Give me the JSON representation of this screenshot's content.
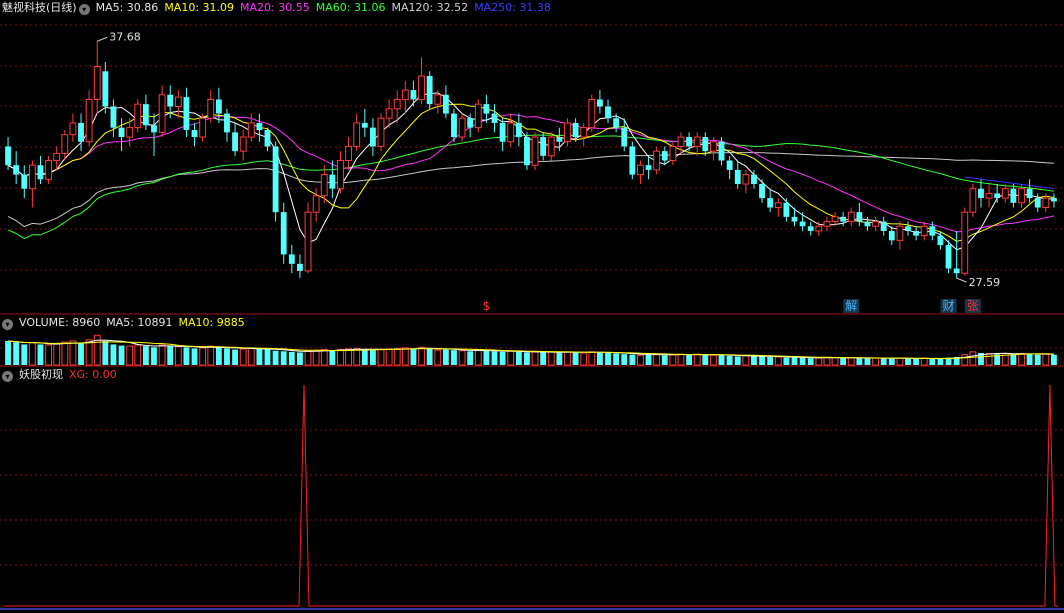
{
  "main_legend": {
    "stock": "魅视科技(日线)",
    "ma5": "MA5: 30.86",
    "ma10": "MA10: 31.09",
    "ma20": "MA20: 30.55",
    "ma60": "MA60: 31.06",
    "ma120": "MA120: 32.52",
    "ma250": "MA250: 31.38"
  },
  "volume_legend": {
    "volume": "VOLUME: 8960",
    "ma5": "MA5: 10891",
    "ma10": "MA10: 9885"
  },
  "indicator_legend": {
    "name": "妖股初现",
    "xg": "XG: 0.00"
  },
  "price_annotations": {
    "high": "37.68",
    "low": "27.59"
  },
  "event_markers": [
    {
      "label": "$",
      "color": "#ff3030"
    },
    {
      "label": "解",
      "color": "#4ab4ff"
    },
    {
      "label": "财",
      "color": "#4ab4ff"
    },
    {
      "label": "张",
      "color": "#ff3030"
    }
  ],
  "colors": {
    "up": "#ff3b3b",
    "down": "#54ffff",
    "ma5": "#ffffff",
    "ma10": "#ffff00",
    "ma20": "#ff33ff",
    "ma60": "#33ff33",
    "ma120": "#c8c8c8",
    "ma250": "#3333ff",
    "grid": "#7a1010",
    "separator": "#a01010"
  },
  "chart_data": [
    {
      "type": "candlestick",
      "title": "魅视科技(日线)",
      "ylim": [
        27.0,
        38.5
      ],
      "candles": [
        [
          33.2,
          33.6,
          32.2,
          32.4
        ],
        [
          32.4,
          33.0,
          31.6,
          32.0
        ],
        [
          32.0,
          32.4,
          31.0,
          31.4
        ],
        [
          31.4,
          32.6,
          30.6,
          32.4
        ],
        [
          32.4,
          32.8,
          31.6,
          31.8
        ],
        [
          31.8,
          32.8,
          31.6,
          32.6
        ],
        [
          32.6,
          33.2,
          32.2,
          32.9
        ],
        [
          32.9,
          33.9,
          32.6,
          33.7
        ],
        [
          33.7,
          34.6,
          33.4,
          34.2
        ],
        [
          34.2,
          34.6,
          33.0,
          33.4
        ],
        [
          33.4,
          35.6,
          33.2,
          35.2
        ],
        [
          35.2,
          37.68,
          34.6,
          36.6
        ],
        [
          36.4,
          36.8,
          34.6,
          34.9
        ],
        [
          34.9,
          35.2,
          33.6,
          34.0
        ],
        [
          34.0,
          34.4,
          33.0,
          33.6
        ],
        [
          33.6,
          34.4,
          33.2,
          34.0
        ],
        [
          34.0,
          35.2,
          33.8,
          35.0
        ],
        [
          35.0,
          35.4,
          33.9,
          34.1
        ],
        [
          34.1,
          34.6,
          32.8,
          33.8
        ],
        [
          33.8,
          35.8,
          33.6,
          35.4
        ],
        [
          35.4,
          35.8,
          34.4,
          34.9
        ],
        [
          34.9,
          35.6,
          34.4,
          35.3
        ],
        [
          35.3,
          35.7,
          33.6,
          33.9
        ],
        [
          33.9,
          34.2,
          33.2,
          33.6
        ],
        [
          33.6,
          34.6,
          33.4,
          34.4
        ],
        [
          34.4,
          35.6,
          34.2,
          35.2
        ],
        [
          35.2,
          35.7,
          34.2,
          34.6
        ],
        [
          34.6,
          34.8,
          33.4,
          33.8
        ],
        [
          33.8,
          34.2,
          32.8,
          33.0
        ],
        [
          33.0,
          33.9,
          32.6,
          33.6
        ],
        [
          33.6,
          34.6,
          33.4,
          34.2
        ],
        [
          34.2,
          34.6,
          33.4,
          33.9
        ],
        [
          33.9,
          34.0,
          33.0,
          33.2
        ],
        [
          33.2,
          33.4,
          30.0,
          30.4
        ],
        [
          30.4,
          30.8,
          28.2,
          28.6
        ],
        [
          28.6,
          29.0,
          27.8,
          28.2
        ],
        [
          28.2,
          28.6,
          27.6,
          27.9
        ],
        [
          27.9,
          30.8,
          27.8,
          30.4
        ],
        [
          30.4,
          31.4,
          30.0,
          31.1
        ],
        [
          31.1,
          32.4,
          30.8,
          32.0
        ],
        [
          32.0,
          32.6,
          31.0,
          31.4
        ],
        [
          31.4,
          33.0,
          31.2,
          32.6
        ],
        [
          32.6,
          33.6,
          32.2,
          33.2
        ],
        [
          33.2,
          34.6,
          33.0,
          34.2
        ],
        [
          34.2,
          34.8,
          33.6,
          34.0
        ],
        [
          34.0,
          34.4,
          32.8,
          33.2
        ],
        [
          33.2,
          34.6,
          33.0,
          34.4
        ],
        [
          34.4,
          35.2,
          34.0,
          34.8
        ],
        [
          34.8,
          35.6,
          34.2,
          35.2
        ],
        [
          35.2,
          36.0,
          34.6,
          35.6
        ],
        [
          35.6,
          36.0,
          34.9,
          35.2
        ],
        [
          35.2,
          37.0,
          35.0,
          36.2
        ],
        [
          36.2,
          36.4,
          34.8,
          35.0
        ],
        [
          35.0,
          35.6,
          34.6,
          35.4
        ],
        [
          35.4,
          35.8,
          34.4,
          34.6
        ],
        [
          34.6,
          34.8,
          33.4,
          33.6
        ],
        [
          33.6,
          34.6,
          33.4,
          34.4
        ],
        [
          34.4,
          34.6,
          33.6,
          34.0
        ],
        [
          34.0,
          35.2,
          33.8,
          35.0
        ],
        [
          35.0,
          35.4,
          34.2,
          34.6
        ],
        [
          34.6,
          35.0,
          33.8,
          34.2
        ],
        [
          34.2,
          34.4,
          33.0,
          33.4
        ],
        [
          33.4,
          34.6,
          33.2,
          34.2
        ],
        [
          34.2,
          34.6,
          33.2,
          33.6
        ],
        [
          33.6,
          33.8,
          32.2,
          32.4
        ],
        [
          32.4,
          33.8,
          32.2,
          33.6
        ],
        [
          33.6,
          33.8,
          32.6,
          32.8
        ],
        [
          32.8,
          33.8,
          32.6,
          33.6
        ],
        [
          33.6,
          34.0,
          33.0,
          33.4
        ],
        [
          33.4,
          34.4,
          33.2,
          34.2
        ],
        [
          34.2,
          34.4,
          33.4,
          33.6
        ],
        [
          33.6,
          34.2,
          33.2,
          34.0
        ],
        [
          34.0,
          35.4,
          33.8,
          35.2
        ],
        [
          35.2,
          35.6,
          34.6,
          34.9
        ],
        [
          34.9,
          35.2,
          34.2,
          34.4
        ],
        [
          34.4,
          34.6,
          33.8,
          34.0
        ],
        [
          34.0,
          34.4,
          33.0,
          33.2
        ],
        [
          33.2,
          33.4,
          31.8,
          32.0
        ],
        [
          32.0,
          32.6,
          31.6,
          32.4
        ],
        [
          32.4,
          32.8,
          31.8,
          32.2
        ],
        [
          32.2,
          33.2,
          32.0,
          33.0
        ],
        [
          33.0,
          33.2,
          32.4,
          32.6
        ],
        [
          32.6,
          33.4,
          32.4,
          33.2
        ],
        [
          33.2,
          33.8,
          32.9,
          33.6
        ],
        [
          33.6,
          33.8,
          33.0,
          33.2
        ],
        [
          33.2,
          33.8,
          32.8,
          33.6
        ],
        [
          33.6,
          33.8,
          32.8,
          33.0
        ],
        [
          33.0,
          33.6,
          32.6,
          33.4
        ],
        [
          33.4,
          33.6,
          32.4,
          32.6
        ],
        [
          32.6,
          32.8,
          31.8,
          32.2
        ],
        [
          32.2,
          32.6,
          31.4,
          31.6
        ],
        [
          31.6,
          32.2,
          31.2,
          32.0
        ],
        [
          32.0,
          32.2,
          31.4,
          31.6
        ],
        [
          31.6,
          31.8,
          30.8,
          31.0
        ],
        [
          31.0,
          31.4,
          30.4,
          30.6
        ],
        [
          30.6,
          31.0,
          30.2,
          30.8
        ],
        [
          30.8,
          31.0,
          30.0,
          30.2
        ],
        [
          30.2,
          30.6,
          29.8,
          30.0
        ],
        [
          30.0,
          30.4,
          29.6,
          29.8
        ],
        [
          29.8,
          30.0,
          29.4,
          29.6
        ],
        [
          29.6,
          30.0,
          29.4,
          29.8
        ],
        [
          29.8,
          30.2,
          29.6,
          30.0
        ],
        [
          30.0,
          30.4,
          29.8,
          30.2
        ],
        [
          30.2,
          30.4,
          29.8,
          30.0
        ],
        [
          30.0,
          30.6,
          29.8,
          30.4
        ],
        [
          30.4,
          30.8,
          29.8,
          30.0
        ],
        [
          30.0,
          30.2,
          29.6,
          29.8
        ],
        [
          29.8,
          30.2,
          29.6,
          30.0
        ],
        [
          30.0,
          30.2,
          29.4,
          29.6
        ],
        [
          29.6,
          29.8,
          29.0,
          29.2
        ],
        [
          29.2,
          30.0,
          28.8,
          29.8
        ],
        [
          29.8,
          30.0,
          29.4,
          29.6
        ],
        [
          29.6,
          29.8,
          29.2,
          29.4
        ],
        [
          29.4,
          30.0,
          29.2,
          29.8
        ],
        [
          29.8,
          30.0,
          29.2,
          29.4
        ],
        [
          29.4,
          29.6,
          28.8,
          29.0
        ],
        [
          29.0,
          29.2,
          27.8,
          28.0
        ],
        [
          28.0,
          29.6,
          27.59,
          27.8
        ],
        [
          27.8,
          30.6,
          27.7,
          30.4
        ],
        [
          30.4,
          31.6,
          30.2,
          31.4
        ],
        [
          31.4,
          31.8,
          30.6,
          31.0
        ],
        [
          31.0,
          31.6,
          30.6,
          31.2
        ],
        [
          31.2,
          31.6,
          30.8,
          31.0
        ],
        [
          31.0,
          31.6,
          30.8,
          31.4
        ],
        [
          31.4,
          31.6,
          30.6,
          30.8
        ],
        [
          30.8,
          31.6,
          30.6,
          31.4
        ],
        [
          31.4,
          31.8,
          30.8,
          31.0
        ],
        [
          31.0,
          31.2,
          30.4,
          30.6
        ],
        [
          30.6,
          31.2,
          30.4,
          31.0
        ],
        [
          31.0,
          31.2,
          30.6,
          30.86
        ]
      ]
    },
    {
      "type": "bar",
      "title": "VOLUME",
      "values": [
        21000,
        20000,
        18000,
        19500,
        18000,
        17500,
        18500,
        20000,
        21000,
        19000,
        22000,
        26000,
        21000,
        18000,
        17000,
        16500,
        17500,
        16500,
        15500,
        17500,
        16500,
        16000,
        15500,
        14500,
        15000,
        16500,
        15500,
        14500,
        13500,
        14000,
        14500,
        14000,
        13500,
        12500,
        12000,
        11500,
        11000,
        12500,
        13000,
        13500,
        13000,
        13500,
        14000,
        14500,
        14000,
        13000,
        13500,
        14000,
        14500,
        15000,
        14500,
        15500,
        14000,
        13000,
        13500,
        13000,
        12500,
        12000,
        13000,
        12500,
        12000,
        11500,
        12000,
        11500,
        11000,
        11500,
        11000,
        11500,
        11000,
        11500,
        11000,
        10500,
        11500,
        11000,
        10500,
        10000,
        9500,
        9000,
        8500,
        9000,
        9500,
        8500,
        9000,
        9500,
        9000,
        9500,
        9000,
        8500,
        8500,
        8000,
        7500,
        8000,
        7500,
        7500,
        7000,
        7000,
        6500,
        6500,
        6500,
        6000,
        6000,
        6500,
        6500,
        6000,
        6500,
        6000,
        6000,
        6000,
        6000,
        5500,
        6000,
        5500,
        5500,
        6000,
        5500,
        5500,
        6500,
        7000,
        9000,
        11500,
        10500,
        10000,
        9500,
        10000,
        9500,
        10000,
        9500,
        9000,
        9500,
        8960
      ]
    },
    {
      "type": "line",
      "title": "妖股初现",
      "series": [
        {
          "name": "XG",
          "spikes_at": [
            37,
            129
          ],
          "values": [
            0,
            1
          ]
        }
      ]
    }
  ]
}
